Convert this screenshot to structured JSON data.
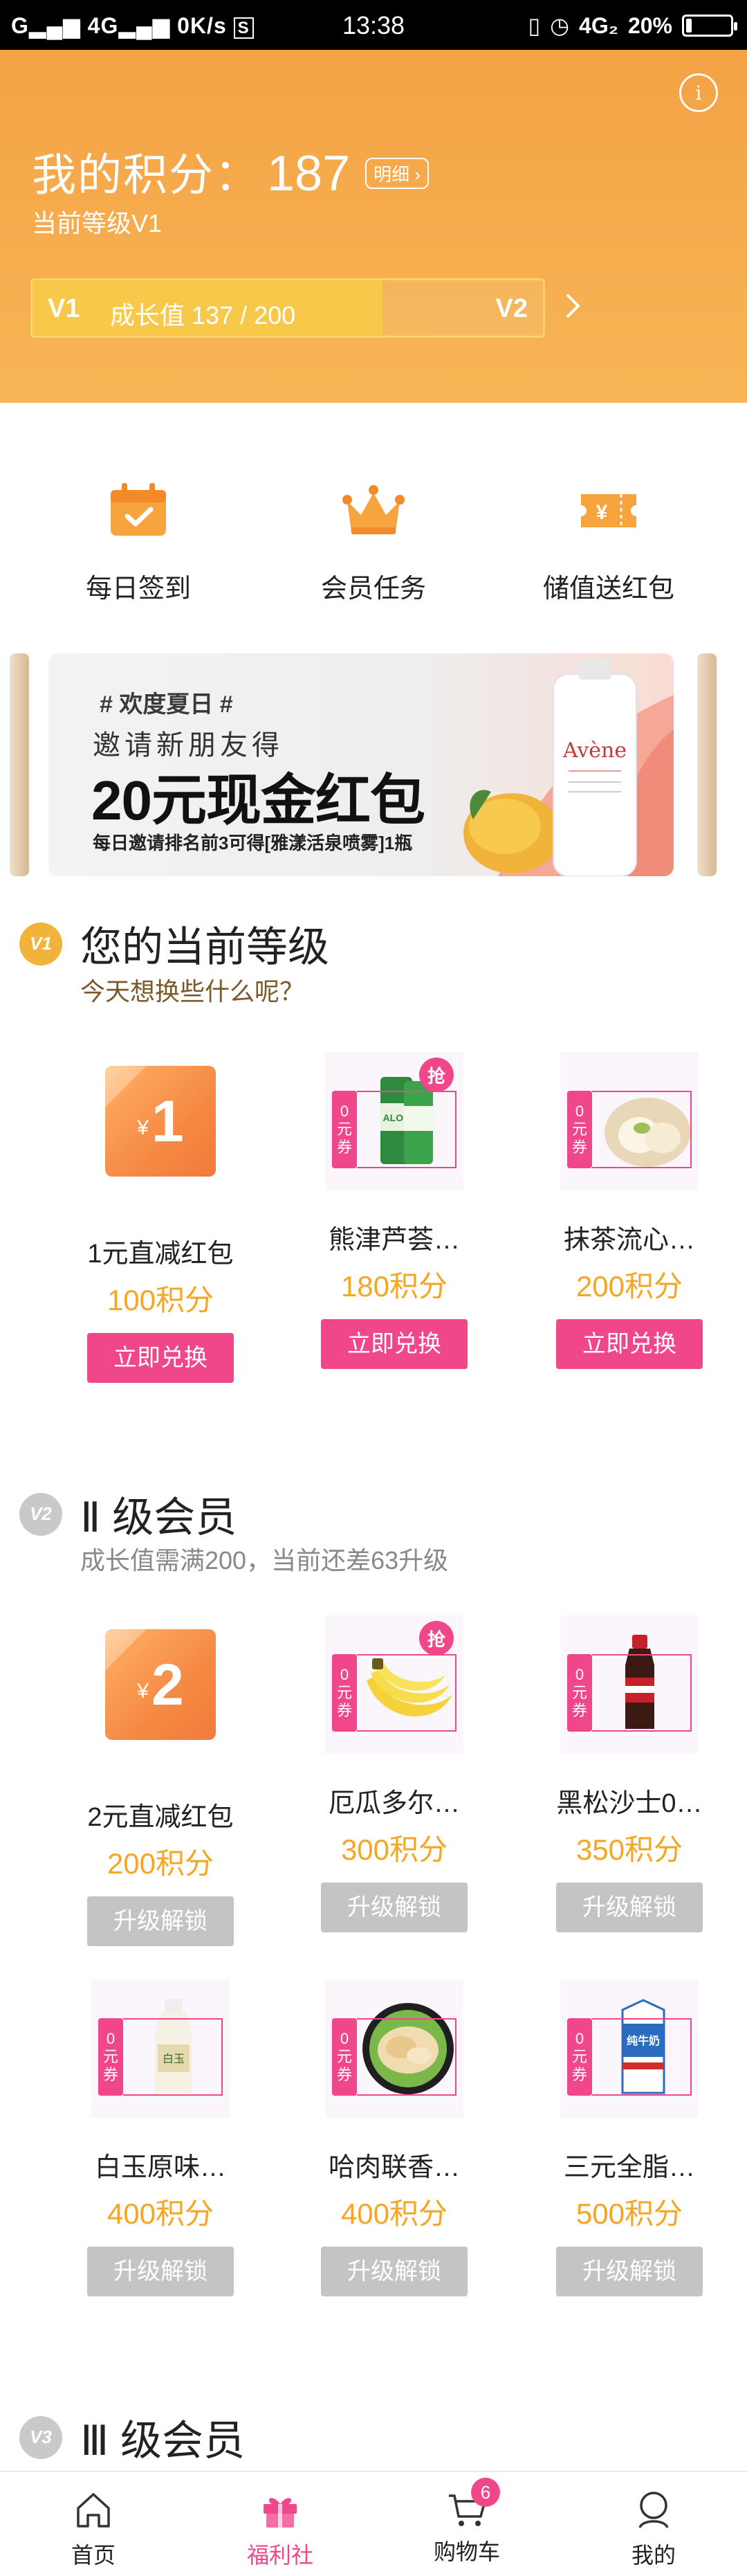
{
  "status_bar": {
    "signal": "Gᴵᴵ 4Gᴵᴵ",
    "speed": "0K/s",
    "time": "13:38",
    "network": "4G₂",
    "battery_text": "20%",
    "battery_level": 0.2
  },
  "header": {
    "points_label": "我的积分：",
    "points_value": "187",
    "detail_label": "明细",
    "level_text": "当前等级V1",
    "growth": {
      "from_level": "V1",
      "label": "成长值 137  / 200",
      "to_level": "V2",
      "progress": 0.685
    }
  },
  "quick_actions": [
    {
      "label": "每日签到",
      "icon": "calendar-check-icon"
    },
    {
      "label": "会员任务",
      "icon": "crown-icon"
    },
    {
      "label": "储值送红包",
      "icon": "coupon-yen-icon"
    }
  ],
  "banner": {
    "tag": "# 欢度夏日 #",
    "line1": "邀请新朋友得",
    "line2": "20元现金红包",
    "line3": "每日邀请排名前3可得[雅漾活泉喷雾]1瓶",
    "brand": "Avène"
  },
  "sections": [
    {
      "badge": "V1",
      "title": "您的当前等级",
      "subtitle": "今天想换些什么呢？",
      "items": [
        {
          "type": "redpack",
          "amount": "1",
          "name": "1元直减红包",
          "points": "100积分",
          "button": "立即兑换"
        },
        {
          "type": "product",
          "name": "熊津芦荟…",
          "points": "180积分",
          "button": "立即兑换",
          "grab": "抢"
        },
        {
          "type": "product",
          "name": "抹茶流心…",
          "points": "200积分",
          "button": "立即兑换"
        }
      ]
    },
    {
      "badge": "V2",
      "title": "Ⅱ 级会员",
      "subtitle": "成长值需满200，当前还差63升级",
      "items": [
        {
          "type": "redpack",
          "amount": "2",
          "name": "2元直减红包",
          "points": "200积分",
          "button": "升级解锁"
        },
        {
          "type": "product",
          "name": "厄瓜多尔…",
          "points": "300积分",
          "button": "升级解锁",
          "grab": "抢"
        },
        {
          "type": "product",
          "name": "黑松沙士0…",
          "points": "350积分",
          "button": "升级解锁"
        },
        {
          "type": "product",
          "name": "白玉原味…",
          "points": "400积分",
          "button": "升级解锁"
        },
        {
          "type": "product",
          "name": "哈肉联香…",
          "points": "400积分",
          "button": "升级解锁"
        },
        {
          "type": "product",
          "name": "三元全脂…",
          "points": "500积分",
          "button": "升级解锁"
        }
      ]
    },
    {
      "badge": "V3",
      "title": "Ⅲ 级会员"
    }
  ],
  "coupon_label": "0元券",
  "yen_symbol": "¥",
  "bottom_nav": [
    {
      "label": "首页",
      "icon": "home-icon"
    },
    {
      "label": "福利社",
      "icon": "gift-icon",
      "active": true
    },
    {
      "label": "购物车",
      "icon": "cart-icon",
      "badge": "6"
    },
    {
      "label": "我的",
      "icon": "user-icon"
    }
  ],
  "colors": {
    "header_orange": "#f4a244",
    "accent_pink": "#f0468a",
    "points_orange": "#f5a623",
    "locked_grey": "#c4c4c4"
  }
}
